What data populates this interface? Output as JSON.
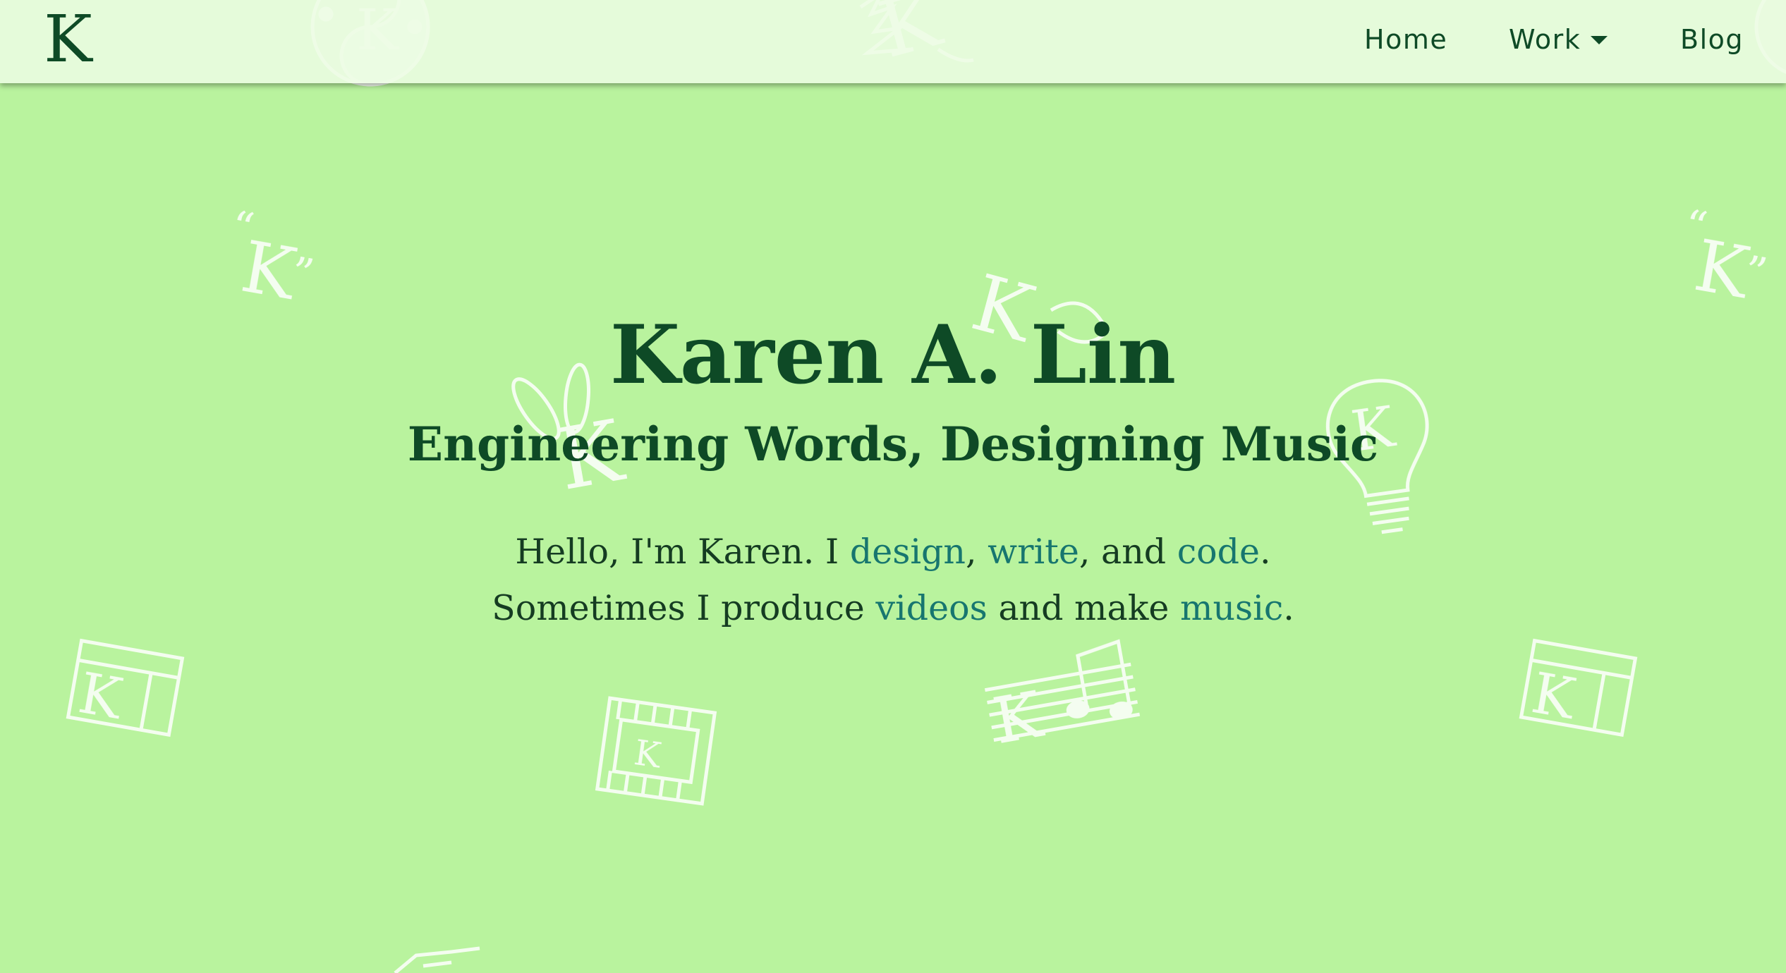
{
  "header": {
    "logo_text": "K",
    "nav": {
      "home": "Home",
      "work": "Work",
      "blog": "Blog"
    }
  },
  "hero": {
    "title": "Karen A. Lin",
    "subtitle": "Engineering Words, Designing Music",
    "line1": {
      "pre": "Hello, I'm Karen. I ",
      "design": "design",
      "sep1": ", ",
      "write": "write",
      "sep2": ", and ",
      "code": "code",
      "end": "."
    },
    "line2": {
      "pre": "Sometimes I produce ",
      "videos": "videos",
      "mid": " and make ",
      "music": "music",
      "end": "."
    }
  },
  "background": {
    "watermark_letter": "K",
    "icons": [
      "yin-yang-k-icon",
      "tree-k-icon",
      "quote-k-icon",
      "bunny-k-icon",
      "fish-k-icon",
      "lightbulb-k-icon",
      "browser-window-k-icon",
      "film-strip-k-icon",
      "music-notes-k-icon"
    ]
  },
  "colors": {
    "background": "#b9f39e",
    "header_bg": "#ecfce4",
    "text_dark": "#0e4a26",
    "link": "#17766f",
    "watermark": "#ffffff"
  }
}
